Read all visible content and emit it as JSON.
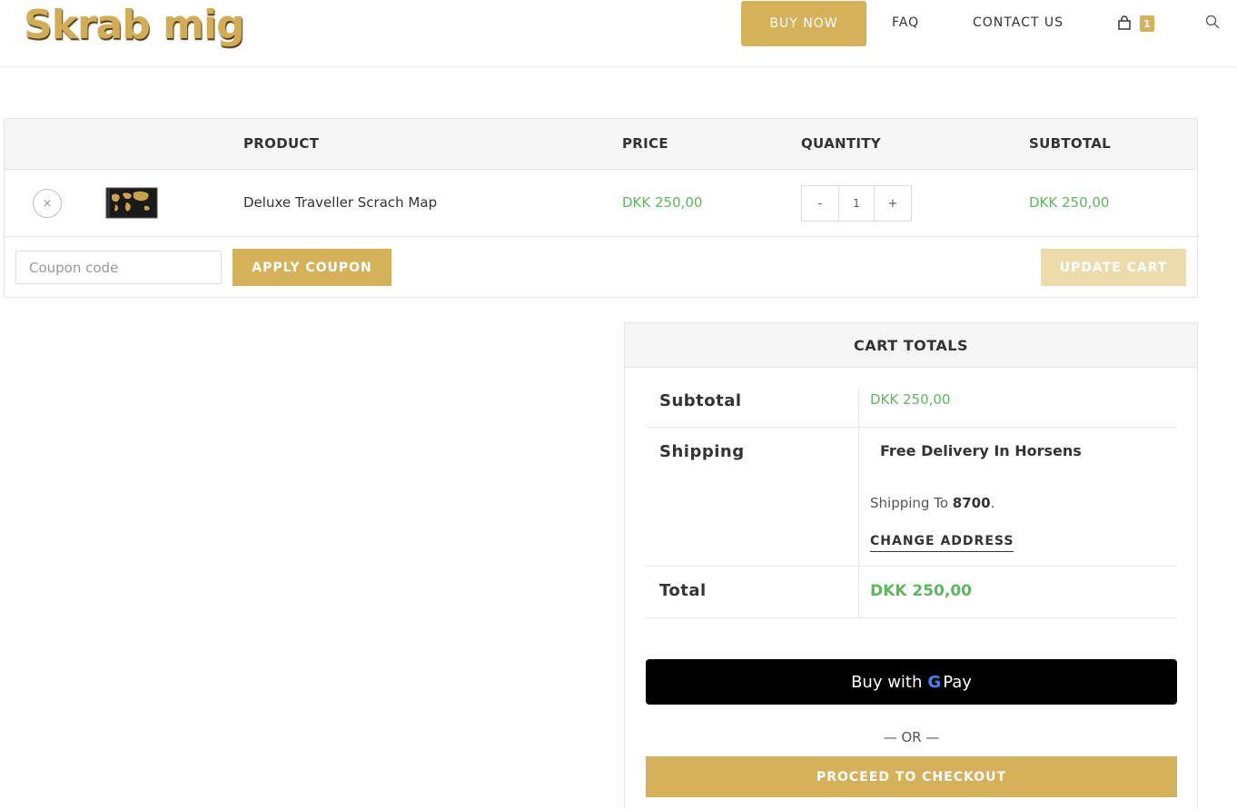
{
  "header": {
    "logo": "Skrab mig",
    "nav": {
      "buy_now": "BUY NOW",
      "faq": "FAQ",
      "contact": "CONTACT US",
      "cart_count": "1"
    }
  },
  "cart": {
    "columns": {
      "product": "PRODUCT",
      "price": "PRICE",
      "quantity": "QUANTITY",
      "subtotal": "SUBTOTAL"
    },
    "items": [
      {
        "remove": "×",
        "name": "Deluxe Traveller Scrach Map",
        "price": "DKK 250,00",
        "qty_minus": "-",
        "qty": "1",
        "qty_plus": "+",
        "subtotal": "DKK 250,00"
      }
    ],
    "coupon_placeholder": "Coupon code",
    "apply_coupon": "APPLY COUPON",
    "update_cart": "UPDATE CART"
  },
  "totals": {
    "title": "CART TOTALS",
    "subtotal_label": "Subtotal",
    "subtotal_value": "DKK 250,00",
    "shipping_label": "Shipping",
    "shipping_method": "Free Delivery In Horsens",
    "shipping_to_text": "Shipping To",
    "shipping_to_value": "8700",
    "change_address": "CHANGE ADDRESS",
    "total_label": "Total",
    "total_value": "DKK 250,00",
    "gpay_text": "Buy with",
    "gpay_g": "G",
    "gpay_pay": "Pay",
    "or": "— OR —",
    "checkout": "PROCEED TO CHECKOUT"
  },
  "colors": {
    "accent": "#d5b15a",
    "price_green": "#5cb85c"
  }
}
